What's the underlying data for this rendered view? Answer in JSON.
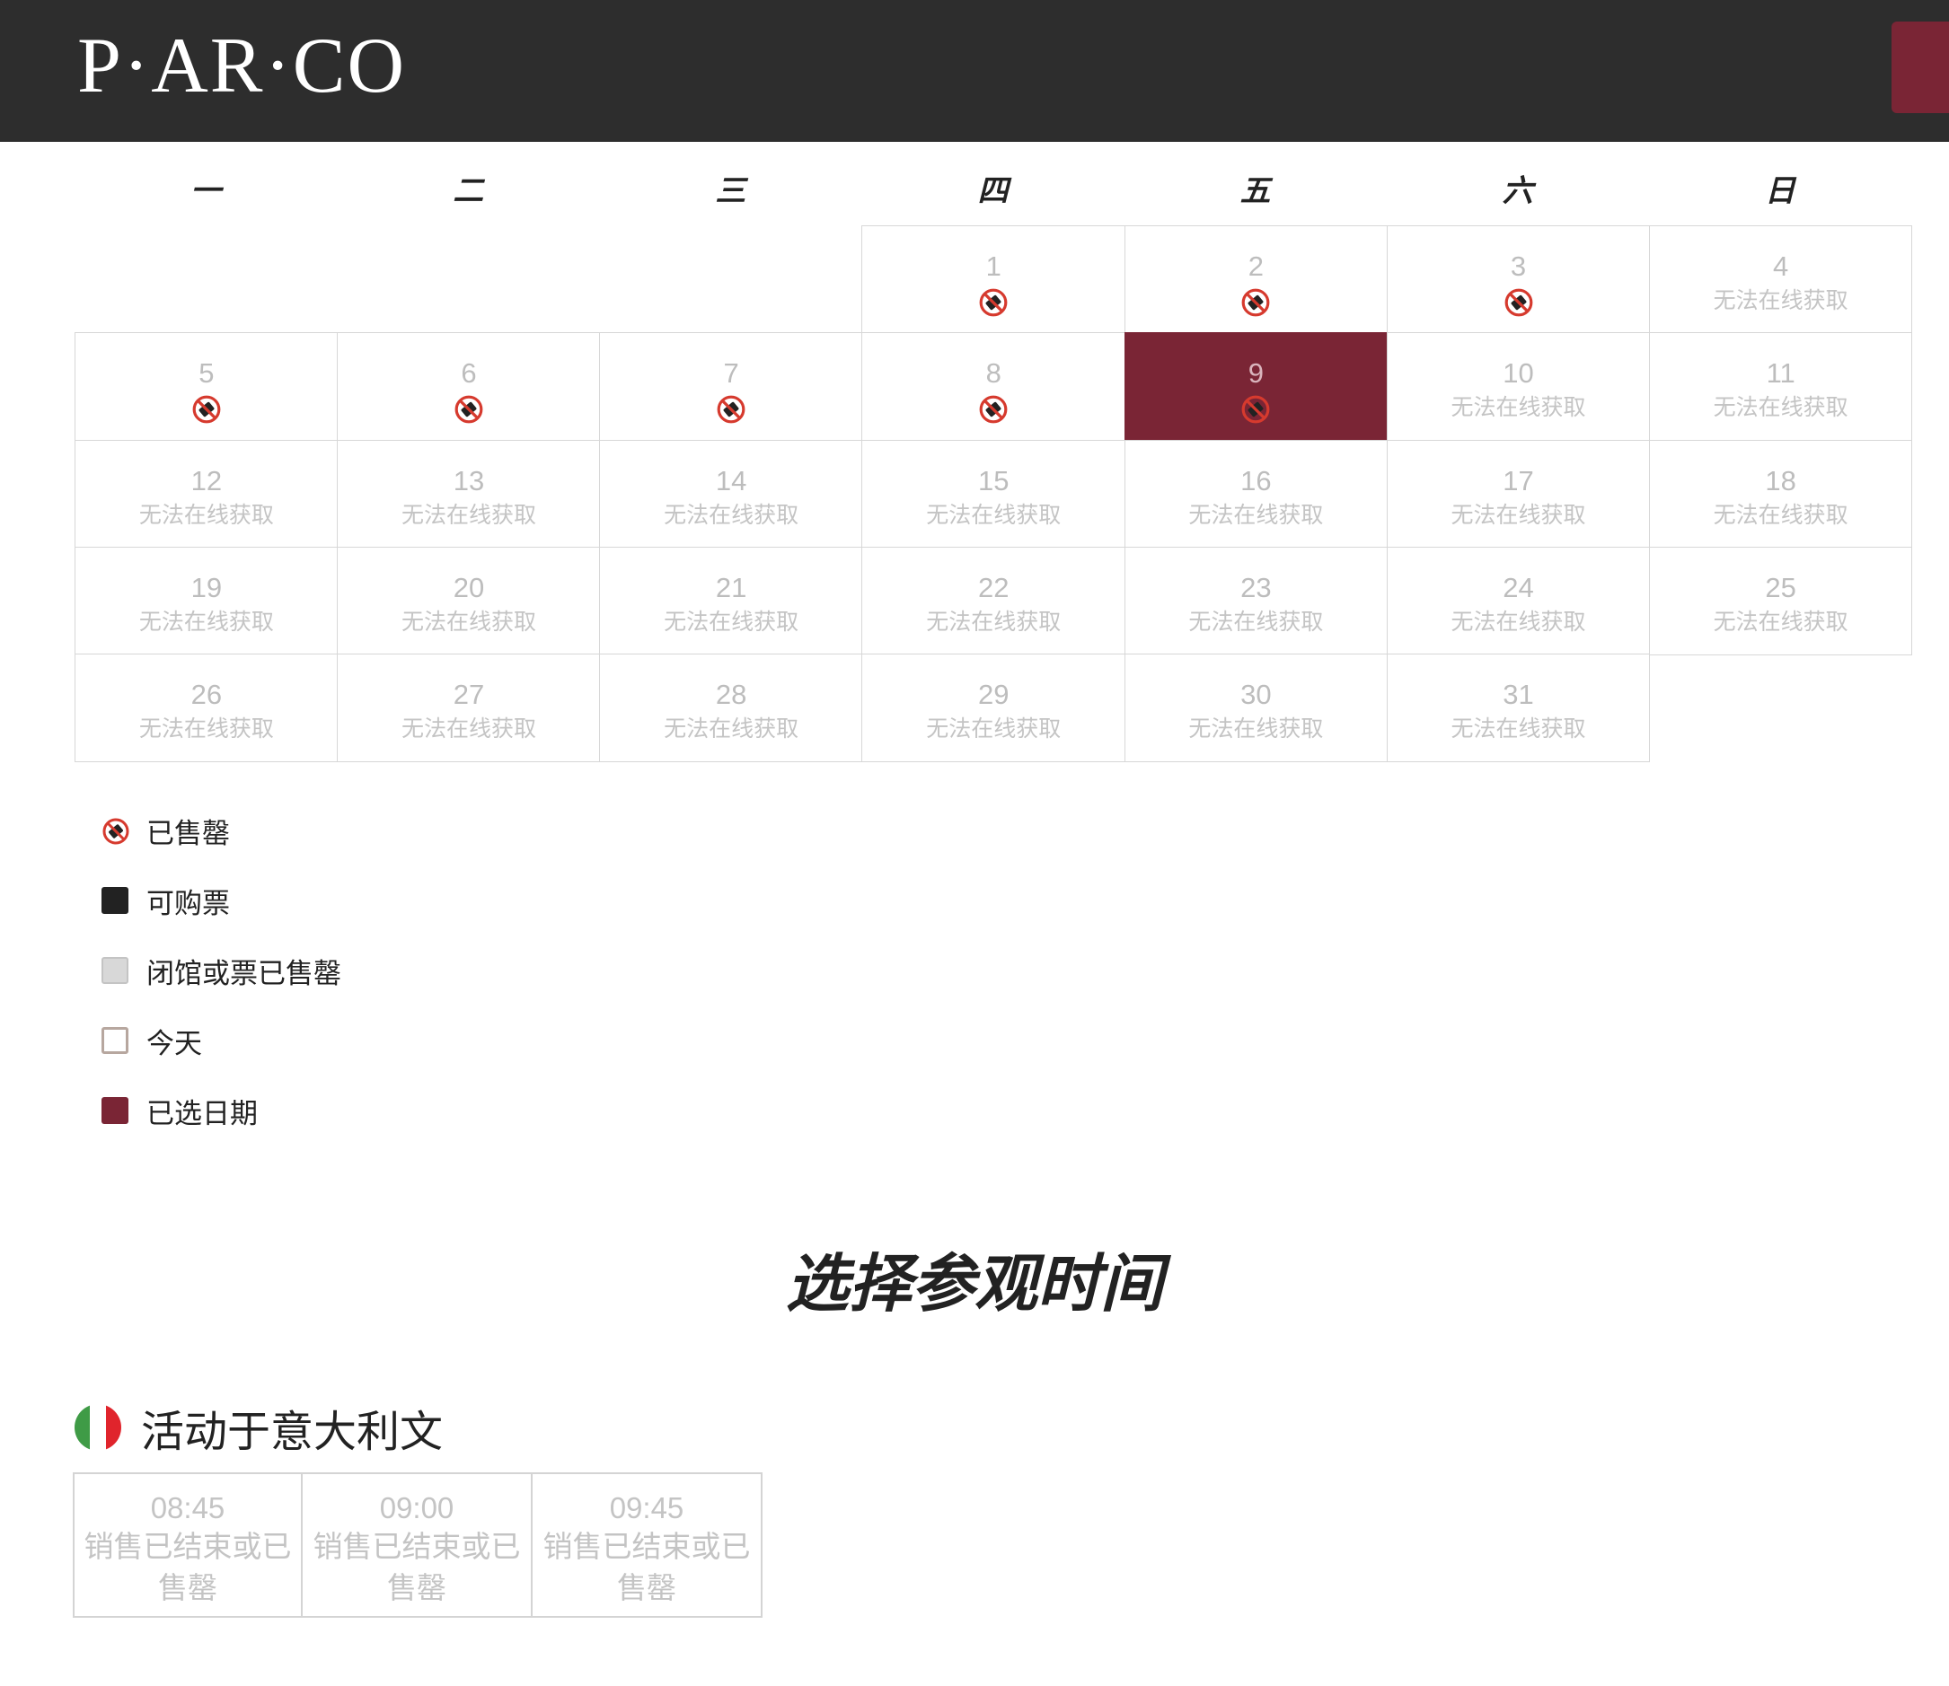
{
  "header": {
    "logo_text": "P·AR·CO",
    "brand_color": "#2d2d2d",
    "accent_color": "#7a2535"
  },
  "calendar": {
    "weekdays": [
      "一",
      "二",
      "三",
      "四",
      "五",
      "六",
      "日"
    ],
    "days": [
      {
        "day": "1",
        "state": "sold_out",
        "label": ""
      },
      {
        "day": "2",
        "state": "sold_out",
        "label": ""
      },
      {
        "day": "3",
        "state": "sold_out",
        "label": ""
      },
      {
        "day": "4",
        "state": "unavailable",
        "label": "无法在线获取"
      },
      {
        "day": "5",
        "state": "sold_out",
        "label": ""
      },
      {
        "day": "6",
        "state": "sold_out",
        "label": ""
      },
      {
        "day": "7",
        "state": "sold_out",
        "label": ""
      },
      {
        "day": "8",
        "state": "sold_out",
        "label": ""
      },
      {
        "day": "9",
        "state": "selected_sold_out",
        "label": ""
      },
      {
        "day": "10",
        "state": "unavailable",
        "label": "无法在线获取"
      },
      {
        "day": "11",
        "state": "unavailable",
        "label": "无法在线获取"
      },
      {
        "day": "12",
        "state": "unavailable",
        "label": "无法在线获取"
      },
      {
        "day": "13",
        "state": "unavailable",
        "label": "无法在线获取"
      },
      {
        "day": "14",
        "state": "unavailable",
        "label": "无法在线获取"
      },
      {
        "day": "15",
        "state": "unavailable",
        "label": "无法在线获取"
      },
      {
        "day": "16",
        "state": "unavailable",
        "label": "无法在线获取"
      },
      {
        "day": "17",
        "state": "unavailable",
        "label": "无法在线获取"
      },
      {
        "day": "18",
        "state": "unavailable",
        "label": "无法在线获取"
      },
      {
        "day": "19",
        "state": "unavailable",
        "label": "无法在线获取"
      },
      {
        "day": "20",
        "state": "unavailable",
        "label": "无法在线获取"
      },
      {
        "day": "21",
        "state": "unavailable",
        "label": "无法在线获取"
      },
      {
        "day": "22",
        "state": "unavailable",
        "label": "无法在线获取"
      },
      {
        "day": "23",
        "state": "unavailable",
        "label": "无法在线获取"
      },
      {
        "day": "24",
        "state": "unavailable",
        "label": "无法在线获取"
      },
      {
        "day": "25",
        "state": "unavailable",
        "label": "无法在线获取"
      },
      {
        "day": "26",
        "state": "unavailable",
        "label": "无法在线获取"
      },
      {
        "day": "27",
        "state": "unavailable",
        "label": "无法在线获取"
      },
      {
        "day": "28",
        "state": "unavailable",
        "label": "无法在线获取"
      },
      {
        "day": "29",
        "state": "unavailable",
        "label": "无法在线获取"
      },
      {
        "day": "30",
        "state": "unavailable",
        "label": "无法在线获取"
      },
      {
        "day": "31",
        "state": "unavailable",
        "label": "无法在线获取"
      }
    ],
    "sold_out_icon": "sold-out-ticket-icon"
  },
  "legend": {
    "sold_out": "已售罄",
    "available": "可购票",
    "closed": "闭馆或票已售罄",
    "today": "今天",
    "selected": "已选日期"
  },
  "time_section": {
    "title": "选择参观时间",
    "language_label": "活动于意大利文",
    "flag_icon": "italy-flag-icon",
    "slots": [
      {
        "time": "08:45",
        "status": "销售已结束或已售罄"
      },
      {
        "time": "09:00",
        "status": "销售已结束或已售罄"
      },
      {
        "time": "09:45",
        "status": "销售已结束或已售罄"
      }
    ]
  }
}
